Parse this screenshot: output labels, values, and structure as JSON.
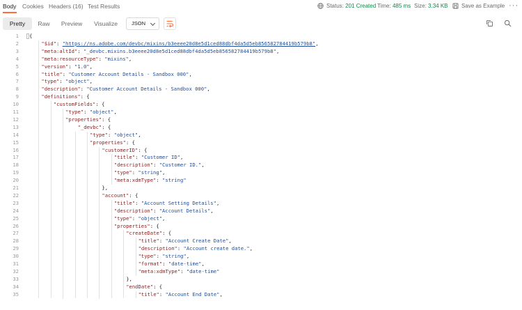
{
  "response_tabs": [
    {
      "label": "Body",
      "active": true
    },
    {
      "label": "Cookies",
      "active": false
    },
    {
      "label": "Headers (16)",
      "active": false
    },
    {
      "label": "Test Results",
      "active": false
    }
  ],
  "status": {
    "label": "Status:",
    "value": "201 Created",
    "color": "#0b8a4a"
  },
  "time": {
    "label": "Time:",
    "value": "485 ms"
  },
  "size": {
    "label": "Size:",
    "value": "3.34 KB"
  },
  "save_example": "Save as Example",
  "more_icon": "ellipsis-icon",
  "view_modes": [
    {
      "label": "Pretty",
      "active": true
    },
    {
      "label": "Raw",
      "active": false
    },
    {
      "label": "Preview",
      "active": false
    },
    {
      "label": "Visualize",
      "active": false
    }
  ],
  "format_select": {
    "value": "JSON"
  },
  "icons": {
    "wrap": "wrap-lines-icon",
    "copy": "copy-icon",
    "search": "search-icon",
    "globe": "globe-icon",
    "save": "save-icon"
  },
  "colors": {
    "key": "#8c1d1d",
    "string": "#1f4d9c",
    "accent": "#ff6c37"
  },
  "code_lines": [
    {
      "n": "1",
      "indent": 0,
      "tokens": [
        {
          "t": "p",
          "v": "{"
        }
      ]
    },
    {
      "n": "2",
      "indent": 1,
      "tokens": [
        {
          "t": "k",
          "v": "\"$id\""
        },
        {
          "t": "p",
          "v": ": "
        },
        {
          "t": "u",
          "v": "\"https://ns.adobe.com/devbc/mixins/b3eeee20d8e5d1ced88dbf4da5d5eb856582784419b579b8\""
        },
        {
          "t": "p",
          "v": ","
        }
      ]
    },
    {
      "n": "3",
      "indent": 1,
      "tokens": [
        {
          "t": "k",
          "v": "\"meta:altId\""
        },
        {
          "t": "p",
          "v": ": "
        },
        {
          "t": "s",
          "v": "\"_devbc.mixins.b3eeee20d8e5d1ced88dbf4da5d5eb856582784419b579b8\""
        },
        {
          "t": "p",
          "v": ","
        }
      ]
    },
    {
      "n": "4",
      "indent": 1,
      "tokens": [
        {
          "t": "k",
          "v": "\"meta:resourceType\""
        },
        {
          "t": "p",
          "v": ": "
        },
        {
          "t": "s",
          "v": "\"mixins\""
        },
        {
          "t": "p",
          "v": ","
        }
      ]
    },
    {
      "n": "5",
      "indent": 1,
      "tokens": [
        {
          "t": "k",
          "v": "\"version\""
        },
        {
          "t": "p",
          "v": ": "
        },
        {
          "t": "s",
          "v": "\"1.0\""
        },
        {
          "t": "p",
          "v": ","
        }
      ]
    },
    {
      "n": "6",
      "indent": 1,
      "tokens": [
        {
          "t": "k",
          "v": "\"title\""
        },
        {
          "t": "p",
          "v": ": "
        },
        {
          "t": "s",
          "v": "\"Customer Account Details - Sandbox 000\""
        },
        {
          "t": "p",
          "v": ","
        }
      ]
    },
    {
      "n": "7",
      "indent": 1,
      "tokens": [
        {
          "t": "k",
          "v": "\"type\""
        },
        {
          "t": "p",
          "v": ": "
        },
        {
          "t": "s",
          "v": "\"object\""
        },
        {
          "t": "p",
          "v": ","
        }
      ]
    },
    {
      "n": "8",
      "indent": 1,
      "tokens": [
        {
          "t": "k",
          "v": "\"description\""
        },
        {
          "t": "p",
          "v": ": "
        },
        {
          "t": "s",
          "v": "\"Customer Account Details - Sandbox 000\""
        },
        {
          "t": "p",
          "v": ","
        }
      ]
    },
    {
      "n": "9",
      "indent": 1,
      "tokens": [
        {
          "t": "k",
          "v": "\"definitions\""
        },
        {
          "t": "p",
          "v": ": {"
        }
      ]
    },
    {
      "n": "10",
      "indent": 2,
      "tokens": [
        {
          "t": "k",
          "v": "\"customFields\""
        },
        {
          "t": "p",
          "v": ": {"
        }
      ]
    },
    {
      "n": "11",
      "indent": 3,
      "tokens": [
        {
          "t": "k",
          "v": "\"type\""
        },
        {
          "t": "p",
          "v": ": "
        },
        {
          "t": "s",
          "v": "\"object\""
        },
        {
          "t": "p",
          "v": ","
        }
      ]
    },
    {
      "n": "12",
      "indent": 3,
      "tokens": [
        {
          "t": "k",
          "v": "\"properties\""
        },
        {
          "t": "p",
          "v": ": {"
        }
      ]
    },
    {
      "n": "13",
      "indent": 4,
      "tokens": [
        {
          "t": "k",
          "v": "\"_devbc\""
        },
        {
          "t": "p",
          "v": ": {"
        }
      ]
    },
    {
      "n": "14",
      "indent": 5,
      "tokens": [
        {
          "t": "k",
          "v": "\"type\""
        },
        {
          "t": "p",
          "v": ": "
        },
        {
          "t": "s",
          "v": "\"object\""
        },
        {
          "t": "p",
          "v": ","
        }
      ]
    },
    {
      "n": "15",
      "indent": 5,
      "tokens": [
        {
          "t": "k",
          "v": "\"properties\""
        },
        {
          "t": "p",
          "v": ": {"
        }
      ]
    },
    {
      "n": "16",
      "indent": 6,
      "tokens": [
        {
          "t": "k",
          "v": "\"customerID\""
        },
        {
          "t": "p",
          "v": ": {"
        }
      ]
    },
    {
      "n": "17",
      "indent": 7,
      "tokens": [
        {
          "t": "k",
          "v": "\"title\""
        },
        {
          "t": "p",
          "v": ": "
        },
        {
          "t": "s",
          "v": "\"Customer ID\""
        },
        {
          "t": "p",
          "v": ","
        }
      ]
    },
    {
      "n": "18",
      "indent": 7,
      "tokens": [
        {
          "t": "k",
          "v": "\"description\""
        },
        {
          "t": "p",
          "v": ": "
        },
        {
          "t": "s",
          "v": "\"Customer ID.\""
        },
        {
          "t": "p",
          "v": ","
        }
      ]
    },
    {
      "n": "19",
      "indent": 7,
      "tokens": [
        {
          "t": "k",
          "v": "\"type\""
        },
        {
          "t": "p",
          "v": ": "
        },
        {
          "t": "s",
          "v": "\"string\""
        },
        {
          "t": "p",
          "v": ","
        }
      ]
    },
    {
      "n": "20",
      "indent": 7,
      "tokens": [
        {
          "t": "k",
          "v": "\"meta:xdmType\""
        },
        {
          "t": "p",
          "v": ": "
        },
        {
          "t": "s",
          "v": "\"string\""
        }
      ]
    },
    {
      "n": "21",
      "indent": 6,
      "tokens": [
        {
          "t": "p",
          "v": "},"
        }
      ]
    },
    {
      "n": "22",
      "indent": 6,
      "tokens": [
        {
          "t": "k",
          "v": "\"account\""
        },
        {
          "t": "p",
          "v": ": {"
        }
      ]
    },
    {
      "n": "23",
      "indent": 7,
      "tokens": [
        {
          "t": "k",
          "v": "\"title\""
        },
        {
          "t": "p",
          "v": ": "
        },
        {
          "t": "s",
          "v": "\"Account Setting Details\""
        },
        {
          "t": "p",
          "v": ","
        }
      ]
    },
    {
      "n": "24",
      "indent": 7,
      "tokens": [
        {
          "t": "k",
          "v": "\"description\""
        },
        {
          "t": "p",
          "v": ": "
        },
        {
          "t": "s",
          "v": "\"Account Details\""
        },
        {
          "t": "p",
          "v": ","
        }
      ]
    },
    {
      "n": "25",
      "indent": 7,
      "tokens": [
        {
          "t": "k",
          "v": "\"type\""
        },
        {
          "t": "p",
          "v": ": "
        },
        {
          "t": "s",
          "v": "\"object\""
        },
        {
          "t": "p",
          "v": ","
        }
      ]
    },
    {
      "n": "26",
      "indent": 7,
      "tokens": [
        {
          "t": "k",
          "v": "\"properties\""
        },
        {
          "t": "p",
          "v": ": {"
        }
      ]
    },
    {
      "n": "27",
      "indent": 8,
      "tokens": [
        {
          "t": "k",
          "v": "\"createDate\""
        },
        {
          "t": "p",
          "v": ": {"
        }
      ]
    },
    {
      "n": "28",
      "indent": 9,
      "tokens": [
        {
          "t": "k",
          "v": "\"title\""
        },
        {
          "t": "p",
          "v": ": "
        },
        {
          "t": "s",
          "v": "\"Account Create Date\""
        },
        {
          "t": "p",
          "v": ","
        }
      ]
    },
    {
      "n": "29",
      "indent": 9,
      "tokens": [
        {
          "t": "k",
          "v": "\"description\""
        },
        {
          "t": "p",
          "v": ": "
        },
        {
          "t": "s",
          "v": "\"Account create date.\""
        },
        {
          "t": "p",
          "v": ","
        }
      ]
    },
    {
      "n": "30",
      "indent": 9,
      "tokens": [
        {
          "t": "k",
          "v": "\"type\""
        },
        {
          "t": "p",
          "v": ": "
        },
        {
          "t": "s",
          "v": "\"string\""
        },
        {
          "t": "p",
          "v": ","
        }
      ]
    },
    {
      "n": "31",
      "indent": 9,
      "tokens": [
        {
          "t": "k",
          "v": "\"format\""
        },
        {
          "t": "p",
          "v": ": "
        },
        {
          "t": "s",
          "v": "\"date-time\""
        },
        {
          "t": "p",
          "v": ","
        }
      ]
    },
    {
      "n": "32",
      "indent": 9,
      "tokens": [
        {
          "t": "k",
          "v": "\"meta:xdmType\""
        },
        {
          "t": "p",
          "v": ": "
        },
        {
          "t": "s",
          "v": "\"date-time\""
        }
      ]
    },
    {
      "n": "33",
      "indent": 8,
      "tokens": [
        {
          "t": "p",
          "v": "},"
        }
      ]
    },
    {
      "n": "34",
      "indent": 8,
      "tokens": [
        {
          "t": "k",
          "v": "\"endDate\""
        },
        {
          "t": "p",
          "v": ": {"
        }
      ]
    },
    {
      "n": "35",
      "indent": 9,
      "tokens": [
        {
          "t": "k",
          "v": "\"title\""
        },
        {
          "t": "p",
          "v": ": "
        },
        {
          "t": "s",
          "v": "\"Account End Date\""
        },
        {
          "t": "p",
          "v": ","
        }
      ]
    }
  ]
}
